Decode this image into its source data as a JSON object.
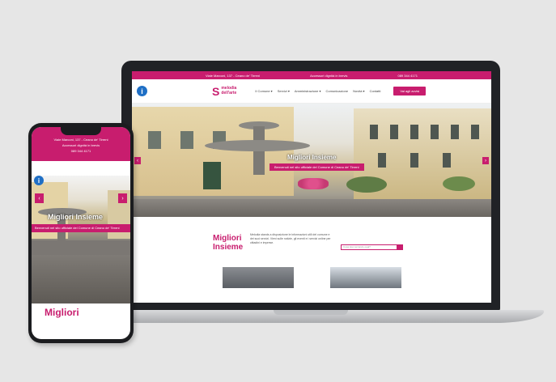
{
  "site": {
    "topbar": {
      "address": "Viale Marconi, 137 - Ceano de' Tirreni",
      "accessibility": "Accessori dignitá in brevis",
      "phone": "089 344 4171"
    },
    "logo": {
      "mark": "S",
      "name": "melodia",
      "tagline": "dell'arte"
    },
    "menu": [
      "Il Comune ▾",
      "Servizi ▾",
      "Amministrazione ▾",
      "Comunicazione",
      "Novità ▾",
      "Contatti"
    ],
    "cta": "Vai agli avvisi",
    "hero": {
      "title": "Migliori Insieme",
      "subtitle": "Benvenuti nel sito ufficiale del Comune di Ceano de' Tirreni",
      "phone_subtitle": "Benvenuti nel sito ufficiale del Comune di Ceano de' Tirreni",
      "prev": "‹",
      "next": "›"
    },
    "intro": {
      "heading_line1": "Migliori",
      "heading_line2": "Insieme",
      "text": "Melodia stands a disposizione le informazioni utili del comune e dei suoi servizi. Vieni sulle notizie, gli eventi e i servizi online per cittadini e imprese.",
      "search_placeholder": "Cosa stai cercando oggi?"
    }
  },
  "phone": {
    "topbar": {
      "address": "Viale Marconi, 137 - Ceano de' Tirreni",
      "accessibility": "Accessori dignitá in brevis",
      "phone": "089 344 4171"
    },
    "hero_title": "Migliori Insieme",
    "heading": "Migliori"
  },
  "colors": {
    "brand": "#c81d6e",
    "info": "#1f6fc5",
    "device": "#202226",
    "background": "#e6e6e6"
  }
}
